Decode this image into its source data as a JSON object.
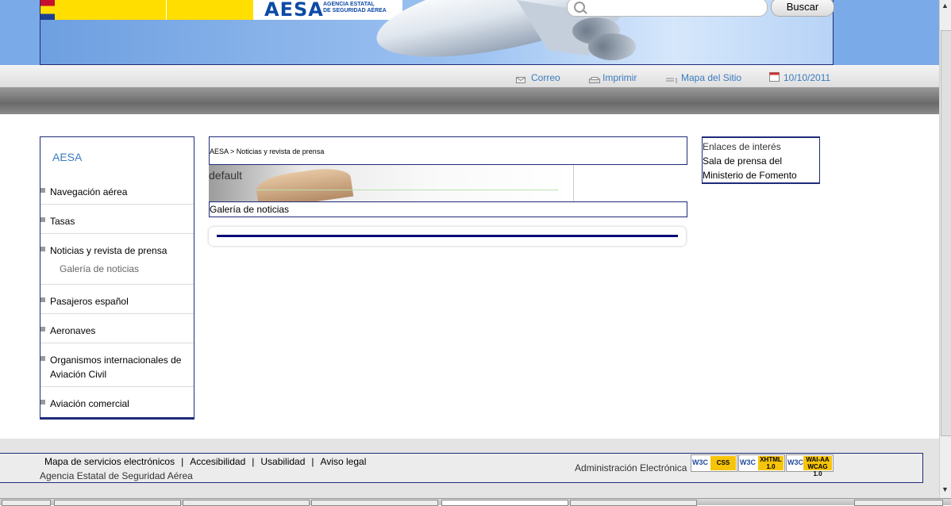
{
  "header": {
    "aesa_logo": "AESA",
    "aesa_sub_1": "AGENCIA ESTATAL",
    "aesa_sub_2": "DE SEGURIDAD AÉREA",
    "search_placeholder": "",
    "search_button": "Buscar"
  },
  "utility": {
    "correo": "Correo",
    "imprimir": "Imprimir",
    "mapa": "Mapa del Sitio",
    "date": "10/10/2011"
  },
  "leftnav": {
    "home": "AESA",
    "items": [
      "Navegación aérea",
      "Tasas",
      "Noticias y revista de prensa",
      "Pasajeros español",
      "Aeronaves",
      "Organismos internacionales de Aviación Civil",
      "Aviación comercial"
    ],
    "sub_item": "Galería de noticias"
  },
  "main": {
    "breadcrumb": "AESA > Noticias y revista de prensa",
    "image_text": "default",
    "section_title": "Galería de noticias"
  },
  "rightbox": {
    "title": "Enlaces de interés",
    "link_1": "Sala de prensa del",
    "link_2": "Ministerio de Fomento"
  },
  "footer": {
    "links": [
      "Mapa de servicios electrónicos",
      "Accesibilidad",
      "Usabilidad",
      "Aviso legal"
    ],
    "separator": "|",
    "org": "Agencia Estatal de Seguridad Aérea",
    "admin": "Administración Electrónica",
    "badges": [
      {
        "w3": "W3C",
        "tag": "CSS"
      },
      {
        "w3": "W3C",
        "tag": "XHTML 1.0"
      },
      {
        "w3": "W3C",
        "tag": "WAI-AA WCAG 1.0"
      }
    ]
  },
  "colors": {
    "navy": "#1f2a78",
    "link_blue": "#3a7bbf",
    "header_yellow": "#ffde00"
  }
}
